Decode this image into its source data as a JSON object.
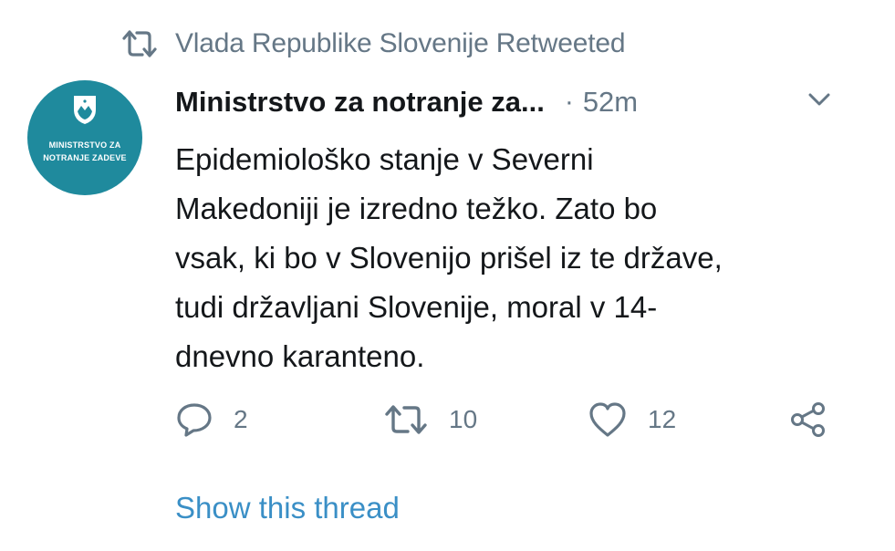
{
  "colors": {
    "accent": "#3a8fc6",
    "muted": "#657786",
    "text": "#14171a",
    "avatar_bg": "#1f8a9d"
  },
  "retweet_context": {
    "icon": "retweet-icon",
    "text": "Vlada Republike Slovenije Retweeted"
  },
  "tweet": {
    "avatar": {
      "line1": "MINISTRSTVO ZA",
      "line2": "NOTRANJE ZADEVE"
    },
    "author_name": "Ministrstvo za notranje za...",
    "separator": "·",
    "time": "52m",
    "menu_icon": "chevron-down-icon",
    "text": "Epidemiološko stanje v Severni\nMakedoniji je izredno težko. Zato bo\nvsak, ki bo v Slovenijo prišel iz te države,\ntudi državljani Slovenije, moral v 14-\ndnevno karanteno.",
    "actions": {
      "reply": {
        "icon": "reply-icon",
        "count": "2"
      },
      "retweet": {
        "icon": "retweet-icon",
        "count": "10"
      },
      "like": {
        "icon": "heart-icon",
        "count": "12"
      },
      "share": {
        "icon": "share-icon"
      }
    }
  },
  "show_thread": "Show this thread"
}
